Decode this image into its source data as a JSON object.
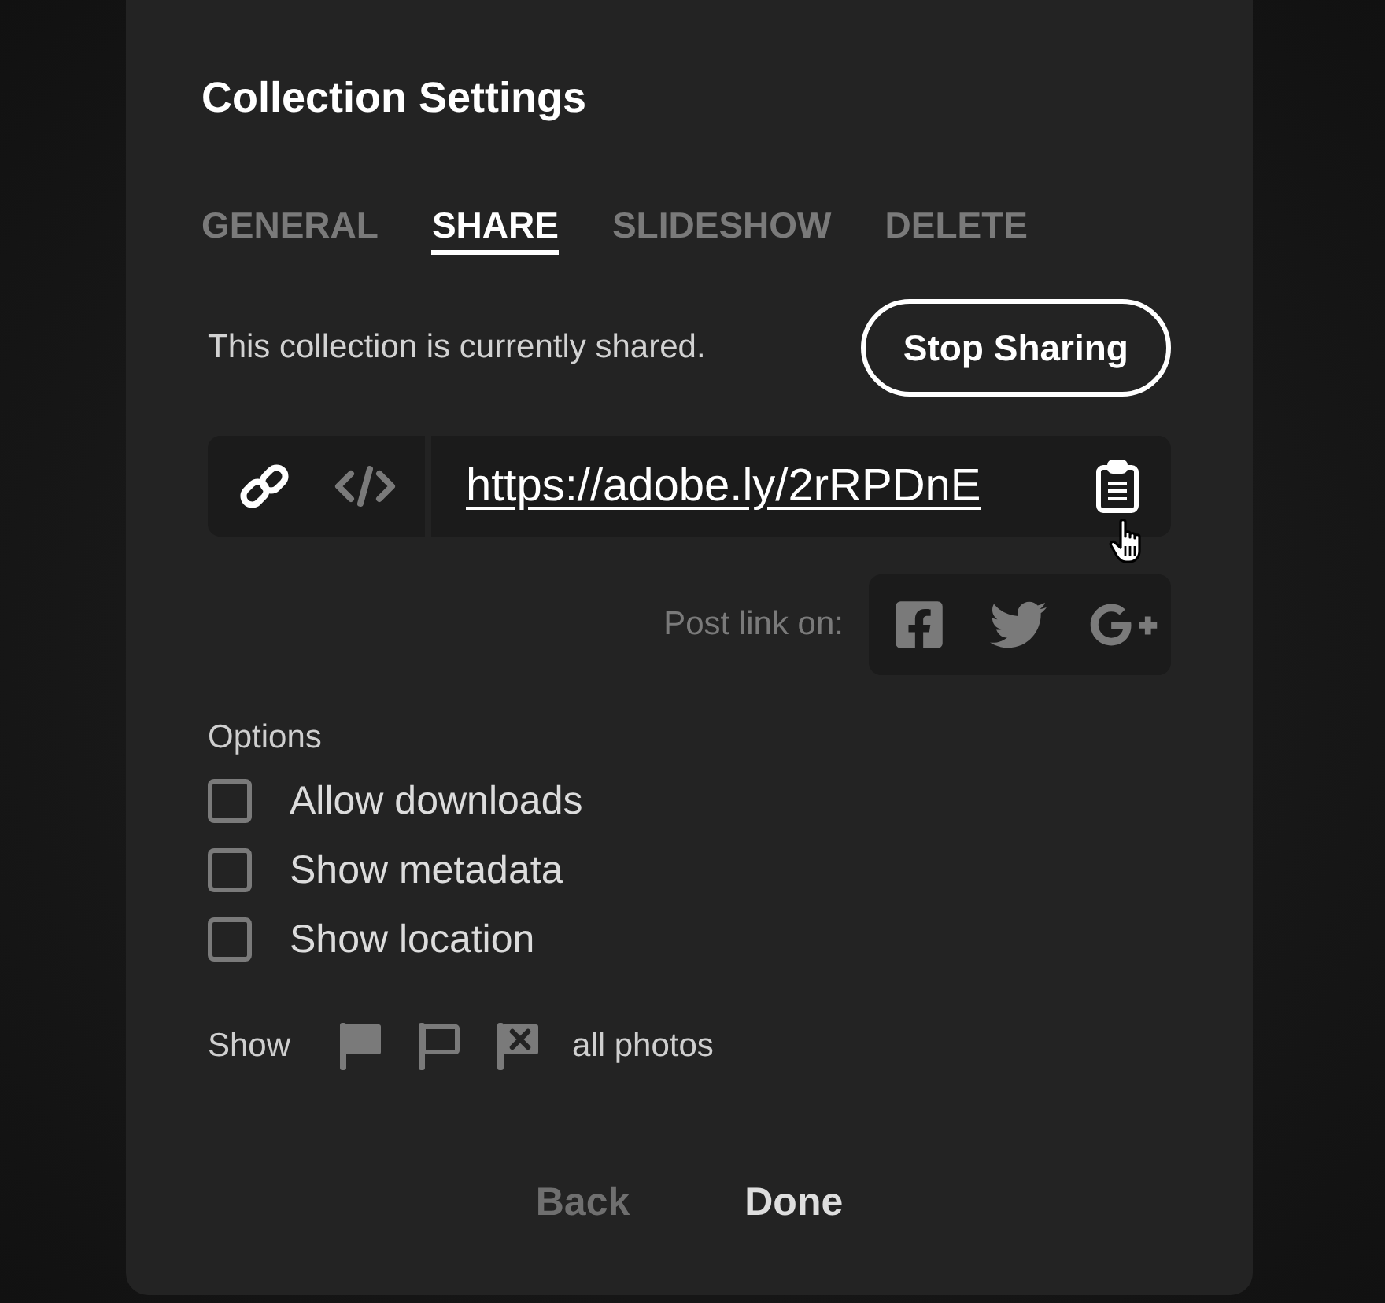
{
  "dialog": {
    "title": "Collection Settings"
  },
  "tabs": [
    {
      "label": "GENERAL",
      "selected": false
    },
    {
      "label": "SHARE",
      "selected": true
    },
    {
      "label": "SLIDESHOW",
      "selected": false
    },
    {
      "label": "DELETE",
      "selected": false
    }
  ],
  "share_status": {
    "text": "This collection is currently shared.",
    "button": "Stop Sharing"
  },
  "link_bar": {
    "formats": [
      {
        "kind": "link",
        "selected": true
      },
      {
        "kind": "embed",
        "selected": false
      }
    ],
    "url": "https://adobe.ly/2rRPDnE"
  },
  "post_link": {
    "label": "Post link on:",
    "networks": [
      {
        "kind": "facebook"
      },
      {
        "kind": "twitter"
      },
      {
        "kind": "google-plus"
      }
    ]
  },
  "options": {
    "label": "Options",
    "items": [
      {
        "label": "Allow downloads",
        "checked": false
      },
      {
        "label": "Show metadata",
        "checked": false
      },
      {
        "label": "Show location",
        "checked": false
      }
    ]
  },
  "show_filter": {
    "label": "Show",
    "filters": [
      {
        "kind": "flagged"
      },
      {
        "kind": "unflagged"
      },
      {
        "kind": "rejected"
      }
    ],
    "value": "all photos"
  },
  "buttons": [
    {
      "label": "Back",
      "disabled": true
    },
    {
      "label": "Done",
      "disabled": false
    }
  ]
}
